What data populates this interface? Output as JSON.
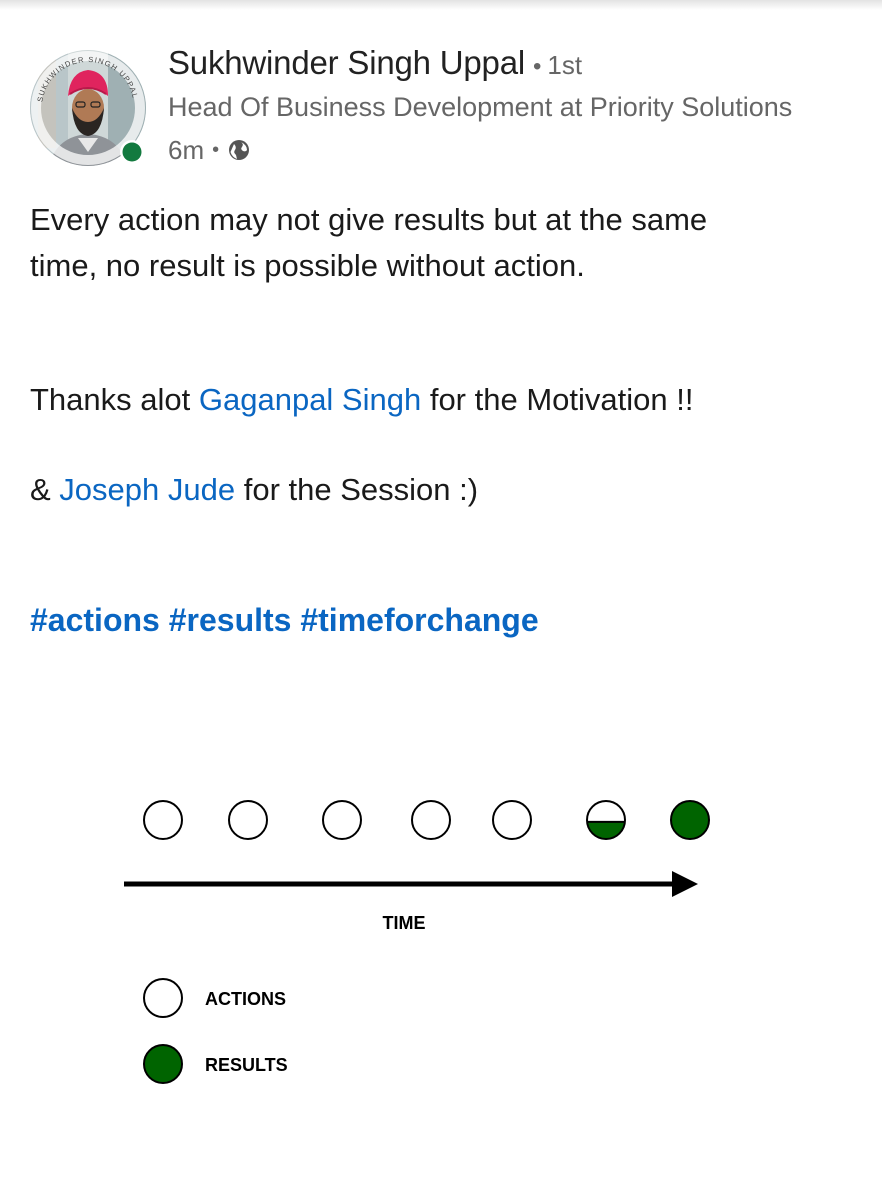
{
  "post": {
    "author": {
      "name": "Sukhwinder Singh Uppal",
      "separator": "•",
      "connection_degree": "1st",
      "headline": "Head Of Business Development at Priority Solutions",
      "time_ago": "6m",
      "meta_separator": "•",
      "visibility_icon": "globe-icon",
      "avatar_ring_text": "SUKHWINDER SINGH UPPAL",
      "online_status_color": "#137a3f"
    },
    "text": {
      "line1": "Every action may not give results but at the same",
      "line2": "time, no result is possible without action.",
      "thanks_prefix": "Thanks alot ",
      "thanks_mention": "Gaganpal Singh",
      "thanks_suffix": " for the Motivation !!",
      "session_prefix": "& ",
      "session_mention": "Joseph Jude",
      "session_suffix": " for the Session :)",
      "hashtags": "#actions #results #timeforchange"
    },
    "colors": {
      "link": "#0a66c2",
      "result_green": "#006400"
    }
  },
  "diagram": {
    "timeline": [
      {
        "kind": "action",
        "fill": 0
      },
      {
        "kind": "action",
        "fill": 0
      },
      {
        "kind": "action",
        "fill": 0
      },
      {
        "kind": "action",
        "fill": 0
      },
      {
        "kind": "action",
        "fill": 0
      },
      {
        "kind": "partial-result",
        "fill": 0.45
      },
      {
        "kind": "result",
        "fill": 1
      }
    ],
    "axis_label": "TIME",
    "legend": [
      {
        "label": "ACTIONS",
        "fill": 0
      },
      {
        "label": "RESULTS",
        "fill": 1
      }
    ]
  }
}
